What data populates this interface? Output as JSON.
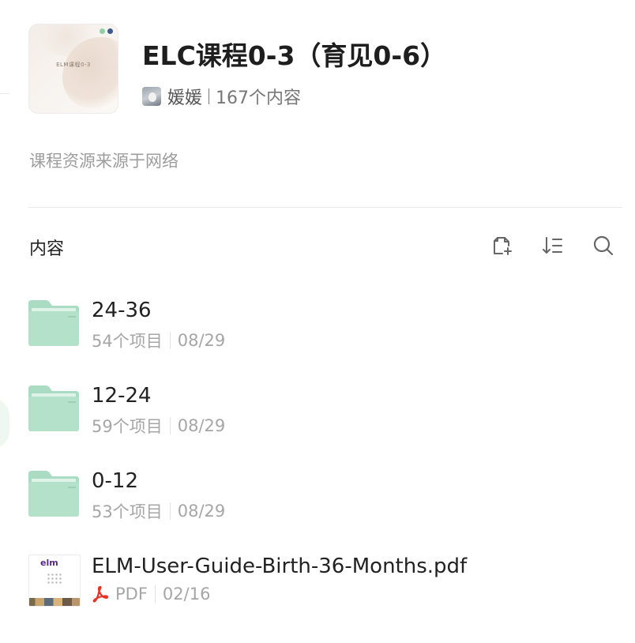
{
  "header": {
    "title": "ELC课程0-3（育见0-6）",
    "author": "媛媛",
    "content_count": "167个内容",
    "cover_title": "ELM课程0-3"
  },
  "description": "课程资源来源于网络",
  "content_section": {
    "title": "内容",
    "tools": [
      "add-file-icon",
      "sort-icon",
      "search-icon"
    ]
  },
  "items": [
    {
      "type": "folder",
      "name": "24-36",
      "count": "54个项目",
      "date": "08/29"
    },
    {
      "type": "folder",
      "name": "12-24",
      "count": "59个项目",
      "date": "08/29"
    },
    {
      "type": "folder",
      "name": "0-12",
      "count": "53个项目",
      "date": "08/29"
    },
    {
      "type": "pdf",
      "name": "ELM-User-Guide-Birth-36-Months.pdf",
      "kind": "PDF",
      "date": "02/16",
      "thumb_logo": "elm"
    }
  ],
  "colors": {
    "folder": "#a9dcc2",
    "folder_tab": "#c3e8d4",
    "pdf_accent": "#e5332a",
    "muted_text": "#a6a6a6"
  }
}
